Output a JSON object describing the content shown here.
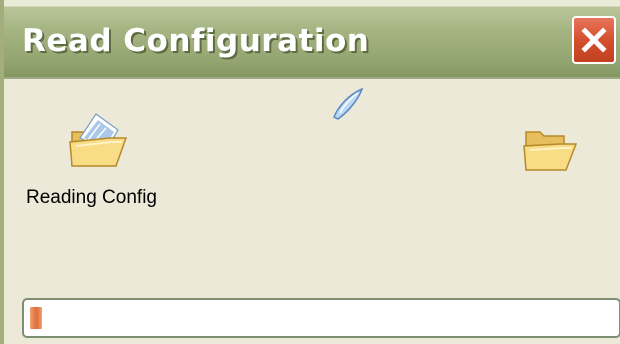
{
  "window": {
    "title": "Read Configuration"
  },
  "icons": {
    "source_folder": "open-folder-with-paper-icon",
    "flying_document": "flying-paper-icon",
    "destination_folder": "open-folder-icon",
    "close": "close-icon"
  },
  "status": {
    "label": "Reading Config"
  },
  "progress": {
    "fraction": 0.02
  },
  "colors": {
    "title_bar": "#a5b482",
    "window_background": "#ece9d8",
    "close_button": "#d4502f",
    "progress_fill": "#e4764a"
  }
}
